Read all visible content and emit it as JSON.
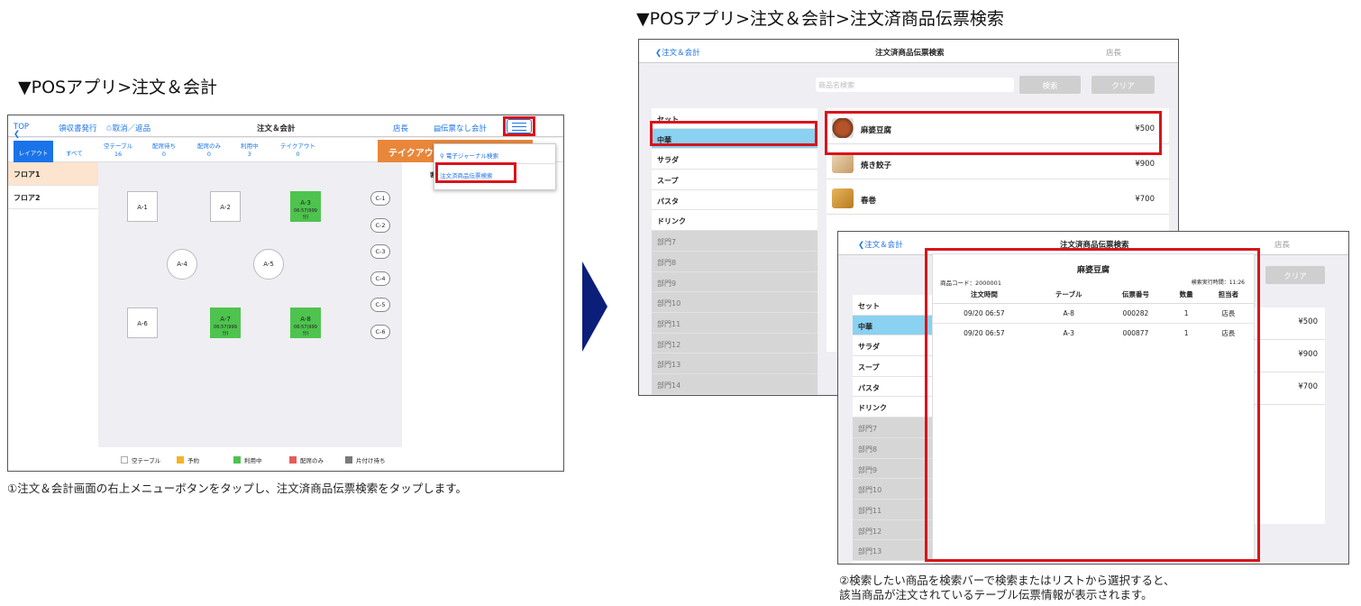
{
  "left_heading": "▼POSアプリ>注文＆会計",
  "left_caption": "①注文＆会計画面の右上メニューボタンをタップし、注文済商品伝票検索をタップします。",
  "right_heading": "▼POSアプリ>注文＆会計>注文済商品伝票検索",
  "right_caption_1": "②検索したい商品を検索バーで検索またはリストから選択すると、",
  "right_caption_2": "該当商品が注文されているテーブル伝票情報が表示されます。",
  "pos": {
    "top": "TOP",
    "receipt": "領収書発行",
    "cancel": "取消／返品",
    "title": "注文＆会計",
    "staff": "店長",
    "no_slip": "伝票なし会計",
    "layout_tab": "レイアウト",
    "all_tab": "すべて",
    "stats": [
      {
        "label": "空テーブル",
        "value": "16"
      },
      {
        "label": "配席待ち",
        "value": "0"
      },
      {
        "label": "配席のみ",
        "value": "0"
      },
      {
        "label": "利用中",
        "value": "3"
      },
      {
        "label": "テイクアウト",
        "value": "0"
      }
    ],
    "takeout_btn": "テイクアウ",
    "guests_label": "客数",
    "floors": [
      "フロア1",
      "フロア2"
    ],
    "menu": {
      "item1": "電子ジャーナル検索",
      "item2": "注文済商品伝票検索"
    },
    "tables": {
      "a1": "A-1",
      "a2": "A-2",
      "a3": "A-3",
      "a3_time": "06:57(999分)",
      "a4": "A-4",
      "a5": "A-5",
      "a6": "A-6",
      "a7": "A-7",
      "a7_time": "06:57(999分)",
      "a8": "A-8",
      "a8_time": "06:57(999分)",
      "c": [
        "C-1",
        "C-2",
        "C-3",
        "C-4",
        "C-5",
        "C-6"
      ]
    },
    "legend": [
      {
        "label": "空テーブル",
        "color": "#ffffff"
      },
      {
        "label": "予約",
        "color": "#f5b325"
      },
      {
        "label": "利用中",
        "color": "#4ec34e"
      },
      {
        "label": "配席のみ",
        "color": "#e85a5a"
      },
      {
        "label": "片付け待ち",
        "color": "#7a7a7a"
      }
    ]
  },
  "search": {
    "back": "注文＆会計",
    "title": "注文済商品伝票検索",
    "staff": "店長",
    "placeholder": "商品名検索",
    "search_btn": "検索",
    "clear_btn": "クリア",
    "categories": [
      "セット",
      "中華",
      "サラダ",
      "スープ",
      "パスタ",
      "ドリンク",
      "部門7",
      "部門8",
      "部門9",
      "部門10",
      "部門11",
      "部門12",
      "部門13",
      "部門14"
    ],
    "products": [
      {
        "name": "麻婆豆腐",
        "price": "¥500"
      },
      {
        "name": "焼き餃子",
        "price": "¥900"
      },
      {
        "name": "春巻",
        "price": "¥700"
      }
    ]
  },
  "detail": {
    "product_name": "麻婆豆腐",
    "code": "商品コード：2000001",
    "exec_time": "検索実行時間：11:26",
    "headers": [
      "注文時間",
      "テーブル",
      "伝票番号",
      "数量",
      "担当者"
    ],
    "rows": [
      [
        "09/20 06:57",
        "A-8",
        "000282",
        "1",
        "店長"
      ],
      [
        "09/20 06:57",
        "A-3",
        "000877",
        "1",
        "店長"
      ]
    ]
  }
}
